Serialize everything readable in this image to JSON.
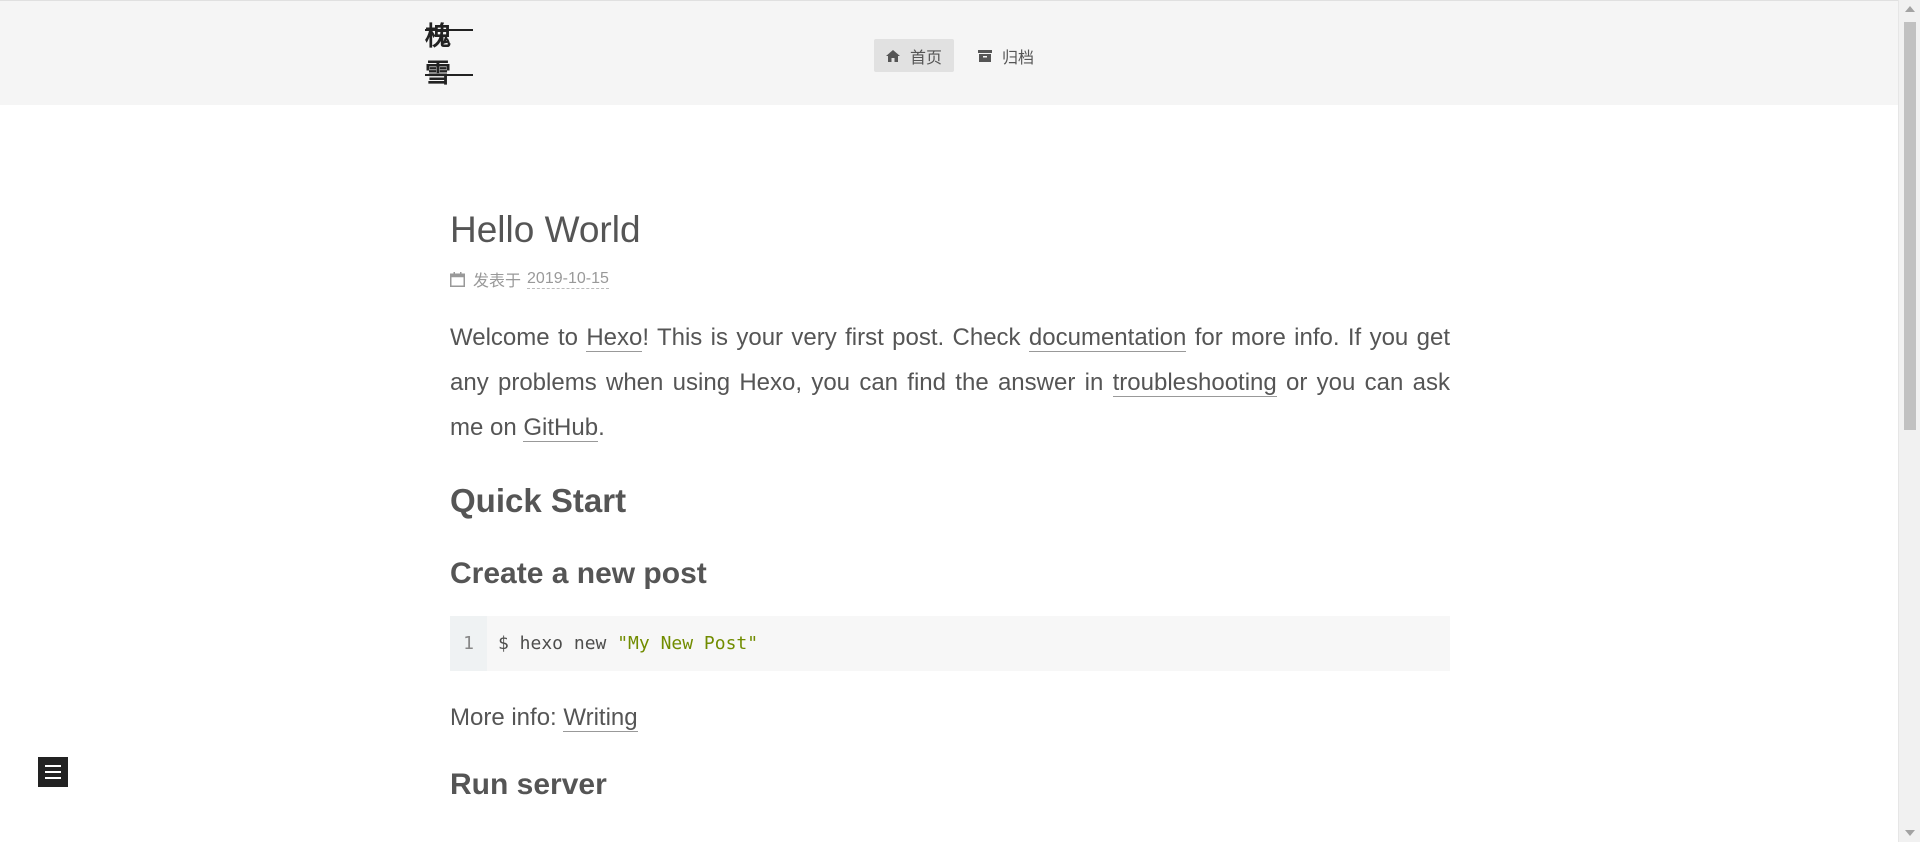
{
  "site": {
    "brand": "槐雪"
  },
  "nav": {
    "items": [
      {
        "label": "首页",
        "icon": "home-icon",
        "active": true
      },
      {
        "label": "归档",
        "icon": "archive-icon",
        "active": false
      }
    ]
  },
  "post": {
    "title": "Hello World",
    "meta_prefix": "发表于",
    "date": "2019-10-15",
    "intro": {
      "t1": "Welcome to ",
      "link_hexo": "Hexo",
      "t2": "! This is your very first post. Check ",
      "link_docs": "documentation",
      "t3": " for more info. If you get any problems when using Hexo, you can find the answer in ",
      "link_trouble": "troubleshooting",
      "t4": " or you can ask me on ",
      "link_github": "GitHub",
      "t5": "."
    },
    "quick_start": "Quick Start",
    "create_post": "Create a new post",
    "code": {
      "line_no": "1",
      "cmd": "$ hexo new ",
      "str": "\"My New Post\""
    },
    "more_info_label": "More info: ",
    "more_info_link": "Writing",
    "run_server": "Run server"
  },
  "colors": {
    "topbar_bg": "#f5f5f5",
    "text": "#555555",
    "code_string": "#718c00"
  }
}
